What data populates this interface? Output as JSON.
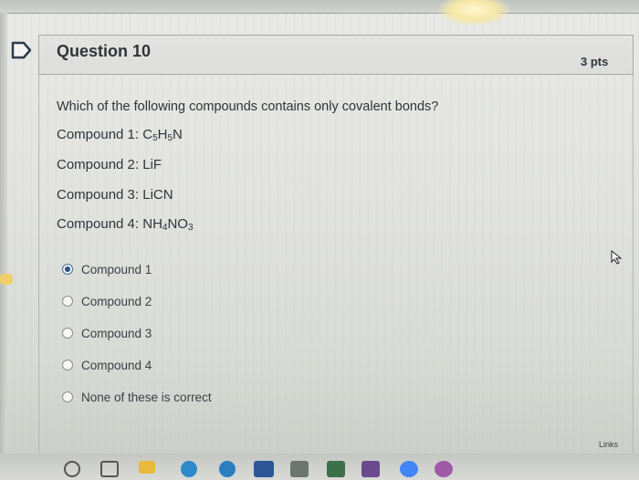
{
  "question": {
    "title": "Question 10",
    "points": "3 pts",
    "prompt": "Which of the following compounds contains only covalent bonds?"
  },
  "compounds": [
    {
      "label": "Compound 1: ",
      "formula": [
        "C",
        "5",
        "H",
        "5",
        "N"
      ]
    },
    {
      "label": "Compound 2: ",
      "formula": [
        "LiF"
      ]
    },
    {
      "label": "Compound 3: ",
      "formula": [
        "LiCN"
      ]
    },
    {
      "label": "Compound 4: ",
      "formula": [
        "NH",
        "4",
        "NO",
        "3"
      ]
    }
  ],
  "answers": [
    {
      "label": "Compound 1",
      "selected": true
    },
    {
      "label": "Compound 2",
      "selected": false
    },
    {
      "label": "Compound 3",
      "selected": false
    },
    {
      "label": "Compound 4",
      "selected": false
    },
    {
      "label": "None of these is correct",
      "selected": false
    }
  ],
  "footer": {
    "links_label": "Links"
  },
  "colors": {
    "accent": "#274f82",
    "text": "#2f3438",
    "header_bg": "#dcddda"
  },
  "taskbar_icons": [
    "search-icon",
    "task-view-icon",
    "file-explorer-icon",
    "edge-icon",
    "word-icon",
    "calculator-icon",
    "photos-icon",
    "onenote-icon",
    "chrome-icon",
    "chrome-profile-icon"
  ]
}
